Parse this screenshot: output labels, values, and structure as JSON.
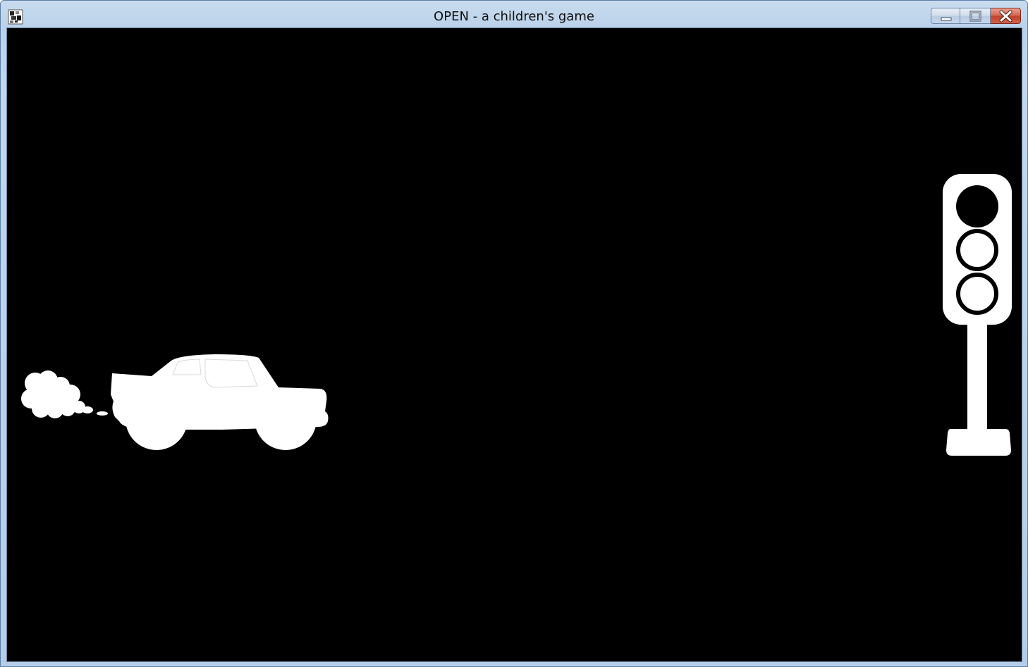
{
  "window": {
    "title": "OPEN - a children's game"
  },
  "icons": {
    "app": "app-icon",
    "minimize": "minimize-icon",
    "maximize": "maximize-icon",
    "close": "close-icon"
  },
  "scene": {
    "background_color": "#000000",
    "sprite_color": "#ffffff",
    "car": "car-silhouette",
    "exhaust": "exhaust-cloud",
    "traffic_light": {
      "name": "traffic-light",
      "lamps": [
        {
          "name": "top-lamp",
          "state": "filled"
        },
        {
          "name": "middle-lamp",
          "state": "outline"
        },
        {
          "name": "bottom-lamp",
          "state": "outline"
        }
      ]
    }
  },
  "colors": {
    "title_text": "#111111",
    "close_button": "#c2412a"
  }
}
